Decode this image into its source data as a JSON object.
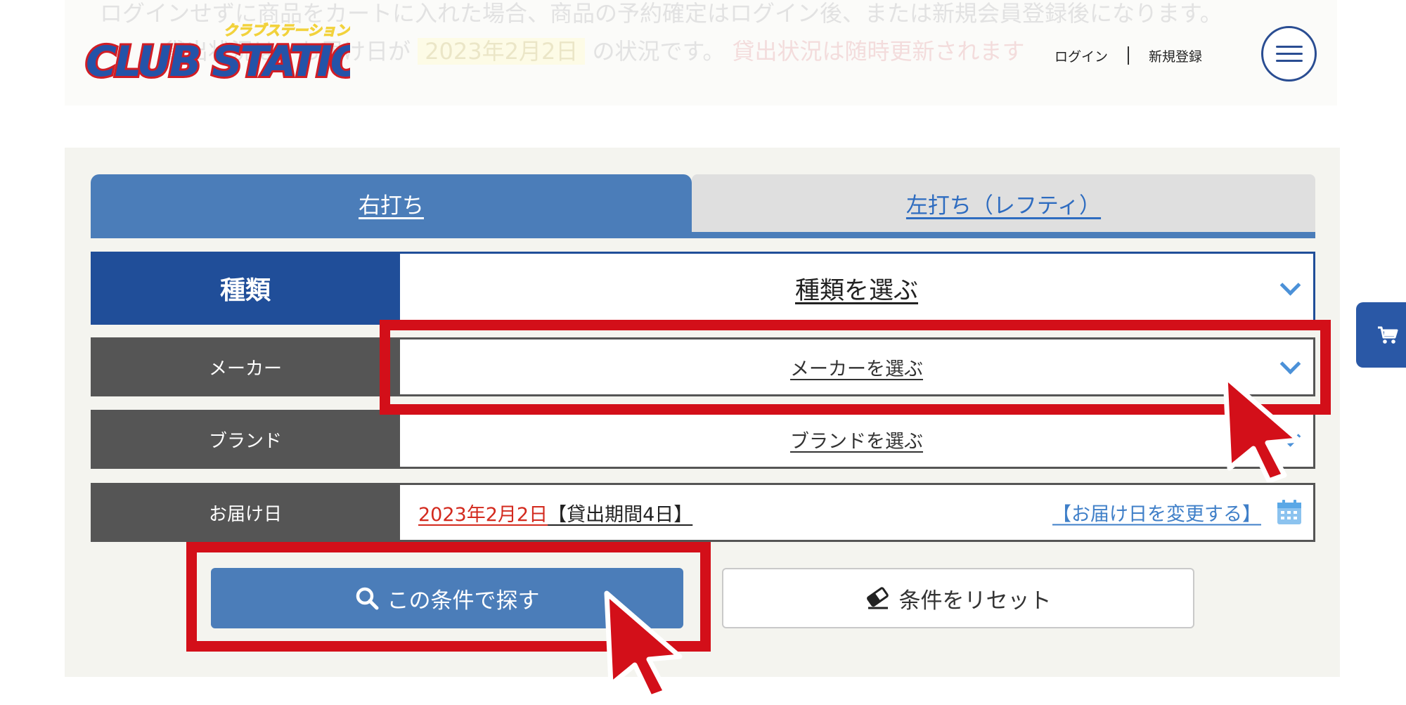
{
  "notice": {
    "line1": "ログインせずに商品をカートに入れた場合、商品の予約確定はログイン後、または新規会員登録後になります。",
    "line2_prefix": "貸出状況は、お届け日が",
    "line2_date": "2023年2月2日",
    "line2_suffix": "の状況です。",
    "line2_red": "貸出状況は随時更新されます"
  },
  "header": {
    "logo_text": "CLUB STATION",
    "logo_kana": "クラブステーション",
    "login": "ログイン",
    "register": "新規登録"
  },
  "tabs": {
    "right_handed": "右打ち",
    "left_handed": "左打ち（レフティ）",
    "active": "right_handed"
  },
  "form": {
    "type_label": "種類",
    "type_placeholder": "種類を選ぶ",
    "maker_label": "メーカー",
    "maker_placeholder": "メーカーを選ぶ",
    "brand_label": "ブランド",
    "brand_placeholder": "ブランドを選ぶ",
    "date_label": "お届け日",
    "date_value": "2023年2月2日",
    "rental_period": "【貸出期間4日】",
    "change_date": "【お届け日を変更する】"
  },
  "buttons": {
    "search": "この条件で探す",
    "reset": "条件をリセット"
  },
  "colors": {
    "primary_blue": "#4b7db9",
    "dark_blue": "#204e99",
    "label_gray": "#555555",
    "highlight_red": "#d30f19",
    "date_red": "#d32a1e"
  }
}
